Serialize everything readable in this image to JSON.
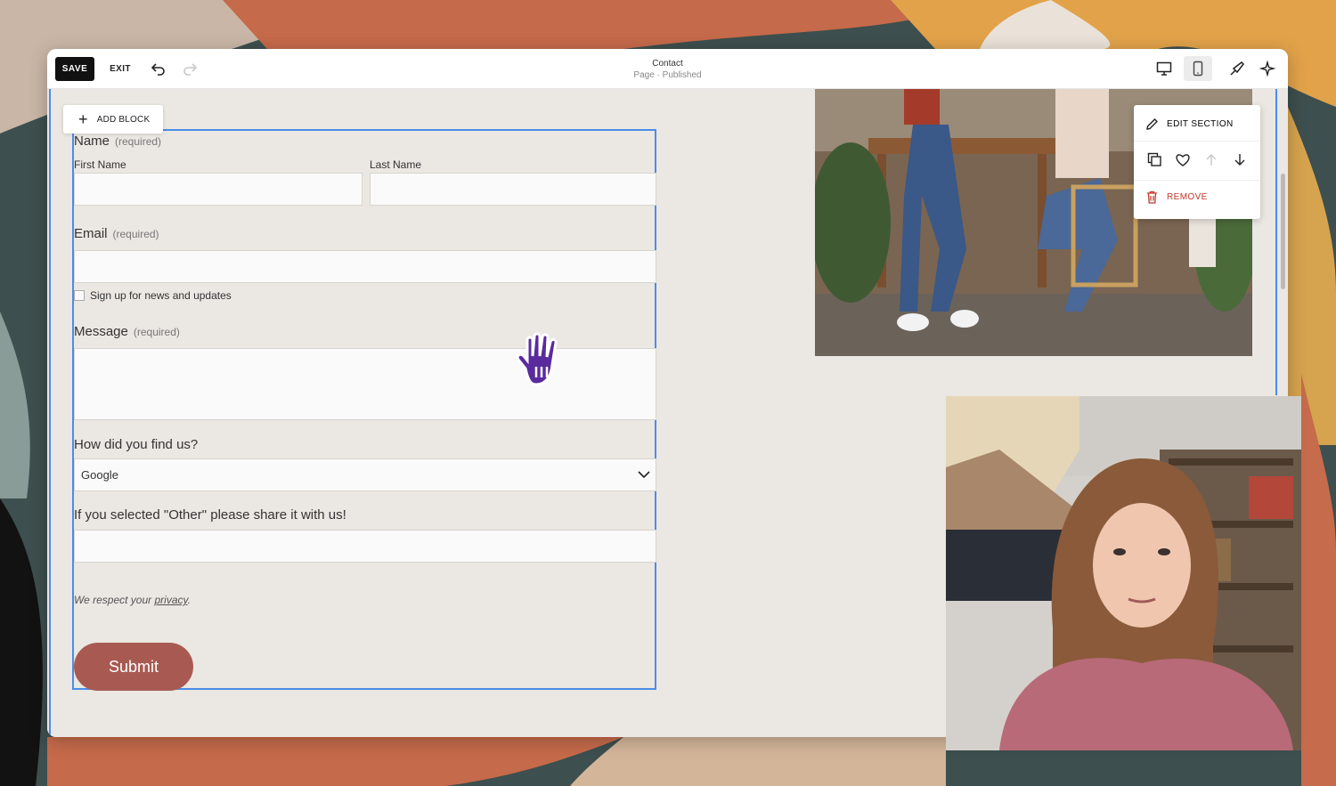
{
  "toolbar": {
    "save_label": "SAVE",
    "exit_label": "EXIT",
    "page_title": "Contact",
    "page_status": "Page · Published"
  },
  "editor": {
    "add_block_label": "ADD BLOCK",
    "section_menu": {
      "edit_label": "EDIT SECTION",
      "remove_label": "REMOVE"
    }
  },
  "form": {
    "name_label": "Name",
    "required_text": "(required)",
    "first_name_label": "First Name",
    "last_name_label": "Last Name",
    "email_label": "Email",
    "newsletter_label": "Sign up for news and updates",
    "message_label": "Message",
    "source_label": "How did you find us?",
    "source_selected": "Google",
    "other_label": "If you selected \"Other\" please share it with us!",
    "privacy_prefix": "We respect your ",
    "privacy_link": "privacy",
    "privacy_suffix": ".",
    "submit_label": "Submit"
  },
  "colors": {
    "accent_blue": "#4a8de8",
    "submit": "#a85a52",
    "canvas": "#ebe7e2",
    "cursor_hand": "#5b2a9e"
  }
}
